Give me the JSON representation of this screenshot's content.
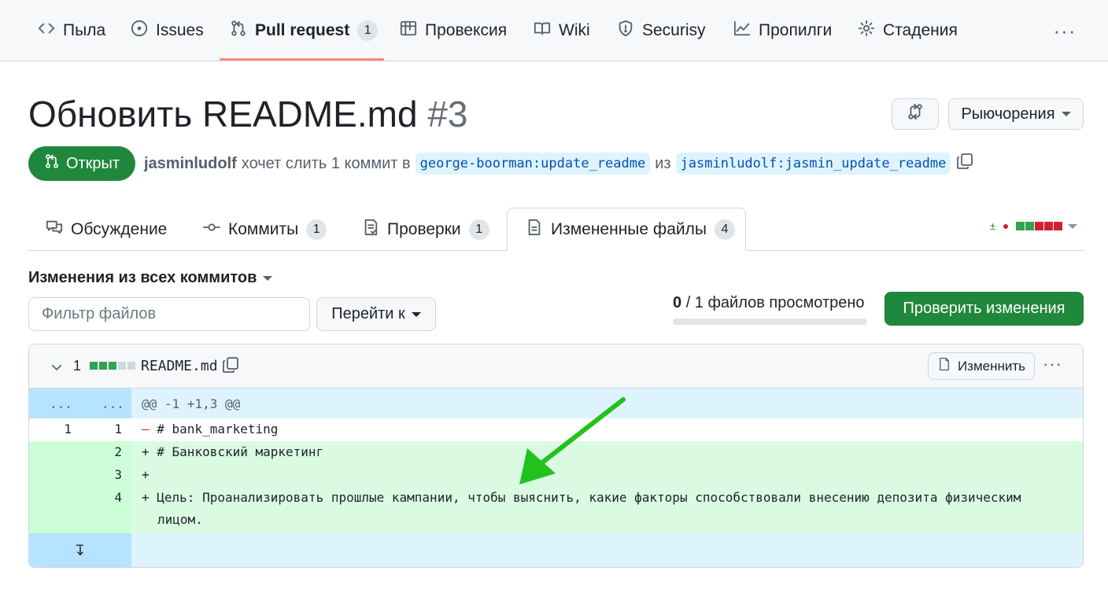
{
  "nav": {
    "items": [
      {
        "label": "Пыла",
        "icon": "code-icon"
      },
      {
        "label": "Issues",
        "icon": "issue-opened-icon"
      },
      {
        "label": "Pull request",
        "icon": "git-pull-request-icon",
        "count": "1",
        "selected": true
      },
      {
        "label": "Провексия",
        "icon": "project-icon"
      },
      {
        "label": "Wiki",
        "icon": "book-icon"
      },
      {
        "label": "Securisy",
        "icon": "shield-icon"
      },
      {
        "label": "Пропилги",
        "icon": "graph-icon"
      },
      {
        "label": "Стадения",
        "icon": "gear-icon"
      }
    ],
    "more_label": "···"
  },
  "pr": {
    "title": "Обновить README.md",
    "number": "#3",
    "state": "Открыт",
    "author": "jasminludolf",
    "action_text": "хочет слить 1 коммит в",
    "base_branch": "george-boorman:update_readme",
    "from_text": "из",
    "head_branch": "jasminludolf:jasmin_update_readme"
  },
  "header_actions": {
    "code_button_icon": "git-compare-icon",
    "dropdown_label": "Рыючорения"
  },
  "tabs": [
    {
      "label": "Обсуждение",
      "icon": "comment-discussion-icon"
    },
    {
      "label": "Коммиты",
      "icon": "git-commit-icon",
      "count": "1"
    },
    {
      "label": "Проверки",
      "icon": "checklist-icon",
      "count": "1"
    },
    {
      "label": "Измененные файлы",
      "icon": "file-diff-icon",
      "count": "4",
      "active": true
    }
  ],
  "diffstat": {
    "additions_label": "±",
    "blocks": [
      "#2da44e",
      "#2da44e",
      "#cf222e",
      "#cf222e",
      "#cf222e"
    ]
  },
  "toolbar": {
    "changes_from": "Изменения из всех коммитов",
    "filter_placeholder": "Фильтр файлов",
    "jump_to": "Перейти к",
    "viewed_count": "0",
    "viewed_total_text": "/ 1 файлов просмотрено",
    "viewed_fraction": 0,
    "review_button": "Проверить изменения"
  },
  "file": {
    "changes_count": "1",
    "blocks": [
      "#2da44e",
      "#2da44e",
      "#2da44e",
      "#d0d7de",
      "#d0d7de"
    ],
    "name": "README.md",
    "edit_label": "Изменнить",
    "more_label": "···"
  },
  "diff": {
    "hunk_left": "...",
    "hunk_right": "...",
    "hunk_header": "@@ -1 +1,3 @@",
    "lines": [
      {
        "type": "del",
        "old": "1",
        "new": "1",
        "sign": "–",
        "text": " # bank_marketing"
      },
      {
        "type": "add",
        "old": "",
        "new": "2",
        "sign": "+",
        "text": " # Банковский маркетинг"
      },
      {
        "type": "add",
        "old": "",
        "new": "3",
        "sign": "+",
        "text": ""
      },
      {
        "type": "add",
        "old": "",
        "new": "4",
        "sign": "+",
        "text": " Цель: Проанализировать прошлые кампании, чтобы выяснить, какие факторы способствовали внесению депозита физическим",
        "cont": "лицом."
      }
    ]
  },
  "colors": {
    "accent_green": "#1f883d",
    "selected_underline": "#fd8c73",
    "annotation_arrow": "#22c11e"
  }
}
